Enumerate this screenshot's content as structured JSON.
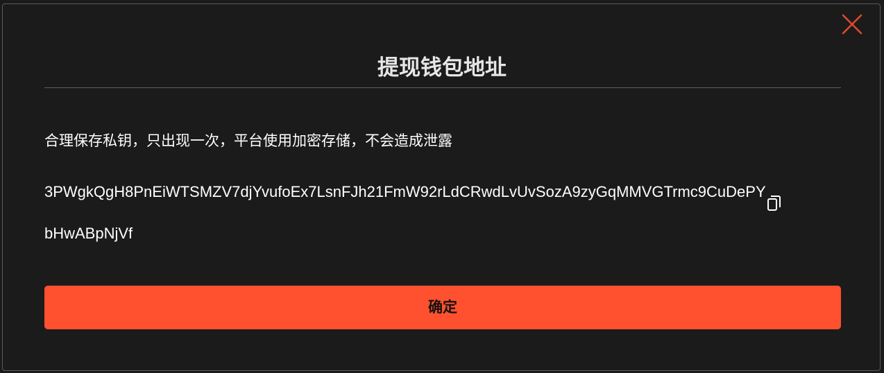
{
  "dialog": {
    "title": "提现钱包地址",
    "notice": "合理保存私钥，只出现一次，平台使用加密存储，不会造成泄露",
    "private_key": "3PWgkQgH8PnEiWTSMZV7djYvufoEx7LsnFJh21FmW92rLdCRwdLvUvSozA9zyGqMMVGTrmc9CuDePYbHwABpNjVf",
    "confirm_label": "确定"
  },
  "icons": {
    "close": "close-icon",
    "copy": "copy-icon"
  },
  "colors": {
    "background": "#1b1b1b",
    "accent": "#ff512f",
    "close_icon": "#e0492e",
    "text": "#ffffff"
  }
}
